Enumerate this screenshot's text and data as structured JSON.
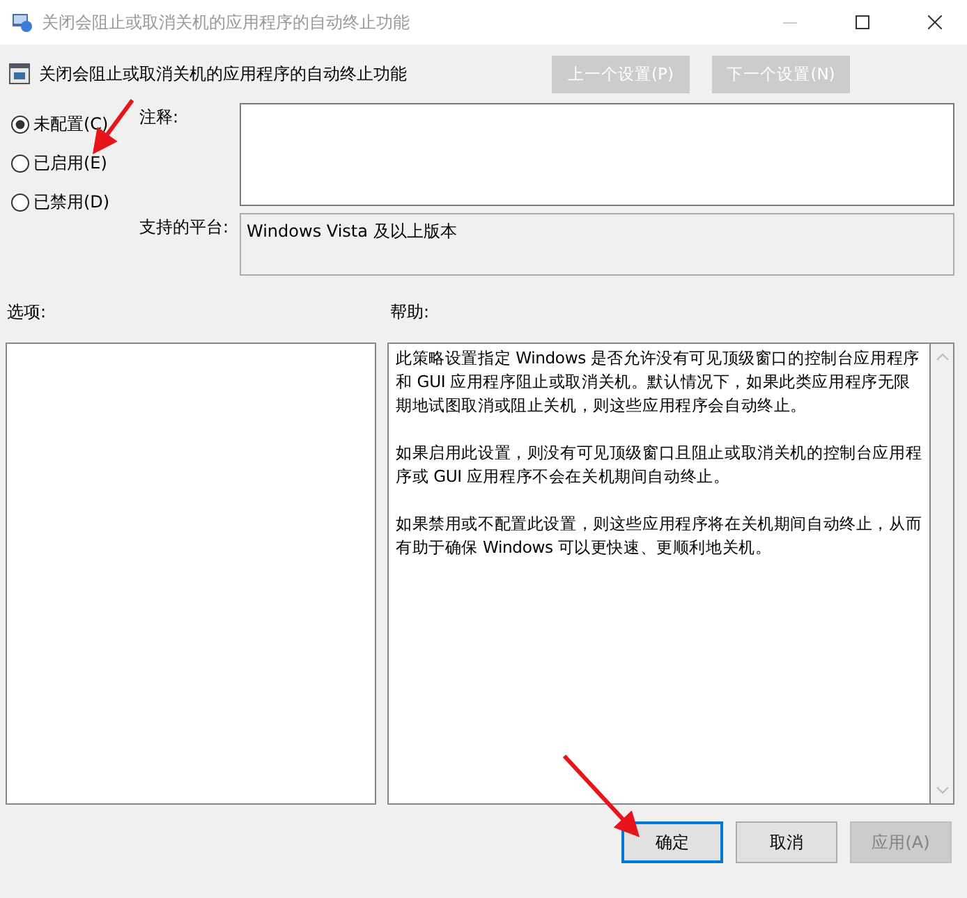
{
  "window": {
    "title": "关闭会阻止或取消关机的应用程序的自动终止功能"
  },
  "header": {
    "title": "关闭会阻止或取消关机的应用程序的自动终止功能"
  },
  "nav_buttons": [
    {
      "label": "上一个设置(P)",
      "disabled": true
    },
    {
      "label": "下一个设置(N)",
      "disabled": true
    }
  ],
  "options": [
    {
      "label": "未配置(C)",
      "selected": true
    },
    {
      "label": "已启用(E)",
      "selected": false
    },
    {
      "label": "已禁用(D)",
      "selected": false
    }
  ],
  "comment": {
    "label": "注释:"
  },
  "platform": {
    "label": "支持的平台:",
    "value": "Windows Vista 及以上版本"
  },
  "options_pane": {
    "label": "选项:"
  },
  "help_pane": {
    "label": "帮助:",
    "paragraphs": [
      "此策略设置指定 Windows 是否允许没有可见顶级窗口的控制台应用程序和 GUI 应用程序阻止或取消关机。默认情况下，如果此类应用程序无限期地试图取消或阻止关机，则这些应用程序会自动终止。",
      "如果启用此设置，则没有可见顶级窗口且阻止或取消关机的控制台应用程序或 GUI 应用程序不会在关机期间自动终止。",
      "如果禁用或不配置此设置，则这些应用程序将在关机期间自动终止，从而有助于确保 Windows 可以更快速、更顺利地关机。"
    ]
  },
  "buttons": [
    {
      "label": "确定",
      "disabled": false,
      "default": true
    },
    {
      "label": "取消",
      "disabled": false,
      "default": false
    },
    {
      "label": "应用(A)",
      "disabled": true,
      "default": false
    }
  ]
}
